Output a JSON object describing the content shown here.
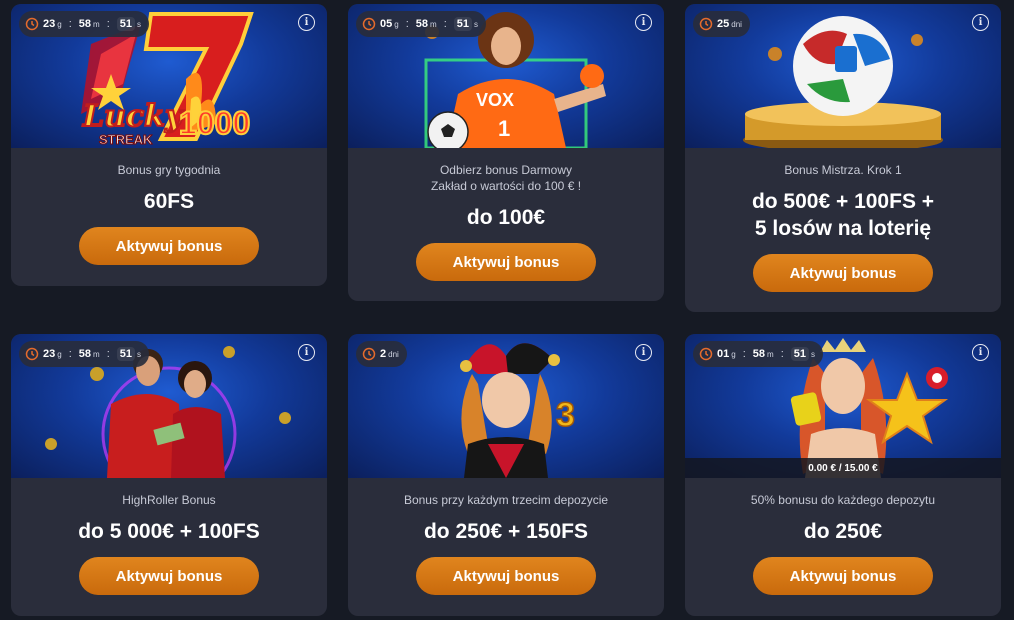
{
  "cards": [
    {
      "timer": {
        "d": "23",
        "d_unit": "g",
        "m": "58",
        "m_unit": "m",
        "s": "51",
        "s_unit": "s"
      },
      "subtitle": "Bonus gry tygodnia",
      "amount": "60FS",
      "button": "Aktywuj bonus",
      "logo": {
        "line1": "Lucky",
        "line2": "STREAK",
        "num": "1000"
      }
    },
    {
      "timer": {
        "d": "05",
        "d_unit": "g",
        "m": "58",
        "m_unit": "m",
        "s": "51",
        "s_unit": "s"
      },
      "subtitle_line1": "Odbierz bonus Darmowy",
      "subtitle_line2": "Zakład o wartości do 100 € !",
      "amount": "do 100€",
      "button": "Aktywuj bonus",
      "jersey": {
        "brand": "VOX",
        "number": "1"
      }
    },
    {
      "timer": {
        "days": "25",
        "unit": "dni"
      },
      "subtitle": "Bonus Mistrza. Krok 1",
      "amount_line1": "do 500€ + 100FS +",
      "amount_line2": "5 losów na loterię",
      "button": "Aktywuj bonus"
    },
    {
      "timer": {
        "d": "23",
        "d_unit": "g",
        "m": "58",
        "m_unit": "m",
        "s": "51",
        "s_unit": "s"
      },
      "subtitle": "HighRoller Bonus",
      "amount": "do 5 000€ + 100FS",
      "button": "Aktywuj bonus"
    },
    {
      "timer": {
        "days": "2",
        "unit": "dni"
      },
      "subtitle": "Bonus przy każdym trzecim depozycie",
      "amount": "do 250€ + 150FS",
      "button": "Aktywuj bonus",
      "badge_number": "3"
    },
    {
      "timer": {
        "d": "01",
        "d_unit": "g",
        "m": "58",
        "m_unit": "m",
        "s": "51",
        "s_unit": "s"
      },
      "progress": "0.00 € / 15.00 €",
      "subtitle": "50% bonusu do każdego depozytu",
      "amount": "do 250€",
      "button": "Aktywuj bonus"
    }
  ],
  "info_label": "i",
  "colors": {
    "background": "#161a24",
    "card": "#2a2d3b",
    "button": "#d57812",
    "banner": "#1a4bb8"
  }
}
